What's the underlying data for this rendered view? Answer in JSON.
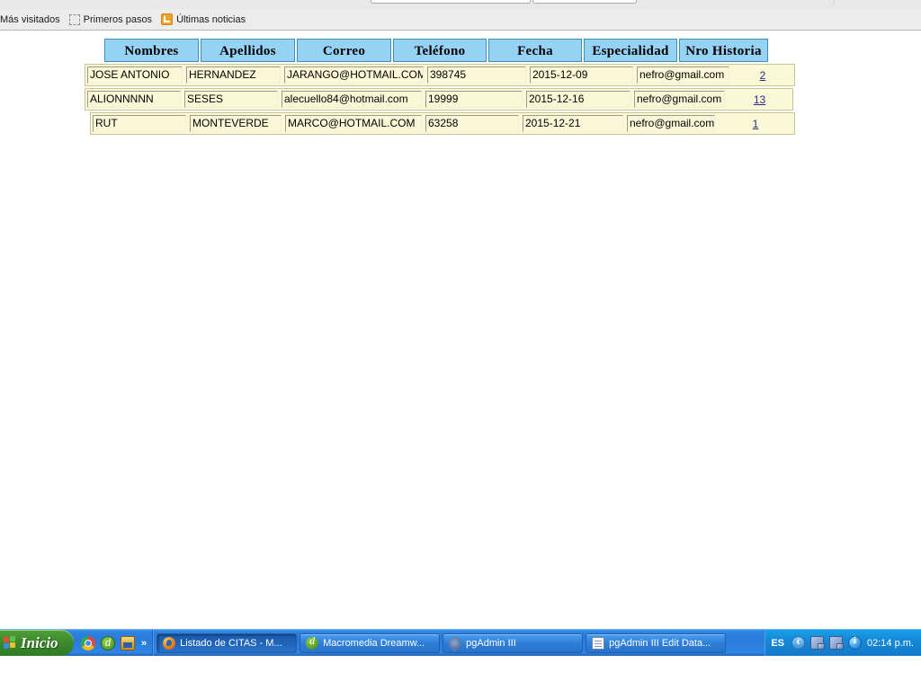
{
  "browser": {
    "bookmarks": [
      {
        "label": "Más visitados",
        "icon": ""
      },
      {
        "label": "Primeros pasos",
        "icon": "dashed-placeholder-icon"
      },
      {
        "label": "Últimas noticias",
        "icon": "rss-feed-icon"
      }
    ]
  },
  "table": {
    "columns": [
      "Nombres",
      "Apellidos",
      "Correo",
      "Teléfono",
      "Fecha",
      "Especialidad",
      "Nro Historia"
    ],
    "rows": [
      {
        "nombres": "JOSE ANTONIO",
        "apellidos": "HERNANDEZ",
        "correo": "JARANGO@HOTMAIL.COM",
        "telefono": "398745",
        "fecha": "2015-12-09",
        "especialidad": "nefro@gmail.com",
        "nro_historia": "2"
      },
      {
        "nombres": "ALIONNNNN",
        "apellidos": "SESES",
        "correo": "alecuello84@hotmail.com",
        "telefono": "19999",
        "fecha": "2015-12-16",
        "especialidad": "nefro@gmail.com",
        "nro_historia": "13"
      },
      {
        "nombres": "RUT",
        "apellidos": "MONTEVERDE",
        "correo": "MARCO@HOTMAIL.COM",
        "telefono": "63258",
        "fecha": "2015-12-21",
        "especialidad": "nefro@gmail.com",
        "nro_historia": "1"
      }
    ]
  },
  "taskbar": {
    "start_label": "Inicio",
    "quick_launch": [
      {
        "name": "chrome-icon"
      },
      {
        "name": "dreamweaver-icon"
      },
      {
        "name": "media-icon"
      }
    ],
    "overflow_label": "»",
    "windows": [
      {
        "label": "Listado de CITAS - M...",
        "icon": "firefox-icon",
        "active": true
      },
      {
        "label": "Macromedia Dreamw...",
        "icon": "dreamweaver-icon",
        "active": false
      },
      {
        "label": "pgAdmin III",
        "icon": "elephant-icon",
        "active": false
      },
      {
        "label": "pgAdmin III Edit Data...",
        "icon": "window-icon",
        "active": false
      }
    ],
    "tray": {
      "language": "ES",
      "icons": [
        "show-hidden-icons-chevron",
        "network-icon",
        "network-icon",
        "info-icon"
      ],
      "clock": "02:14 p.m."
    }
  },
  "colors": {
    "header_blue": "#96d2f4",
    "row_cream": "#fbf8d8",
    "link_blue": "#2a2a8a",
    "taskbar_blue": "#2f7fd8",
    "start_green": "#3d8c2c"
  }
}
